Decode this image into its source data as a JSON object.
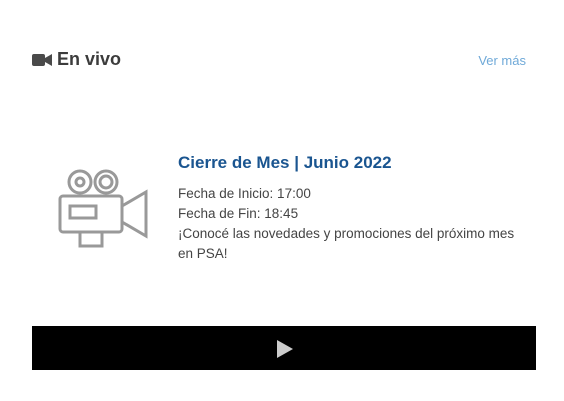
{
  "header": {
    "icon": "video-camera-icon",
    "title": "En vivo",
    "more_label": "Ver más"
  },
  "event": {
    "icon": "movie-camera-icon",
    "title": "Cierre de Mes | Junio 2022",
    "start": "Fecha de Inicio: 17:00",
    "end": "Fecha de Fin: 18:45",
    "description": "¡Conocé las novedades y promociones del próximo mes en PSA!"
  },
  "player": {
    "icon": "play-icon"
  },
  "colors": {
    "title": "#3c3c3c",
    "link": "#6fa9d8",
    "event_title": "#1a5590",
    "player_bg": "#000000"
  }
}
